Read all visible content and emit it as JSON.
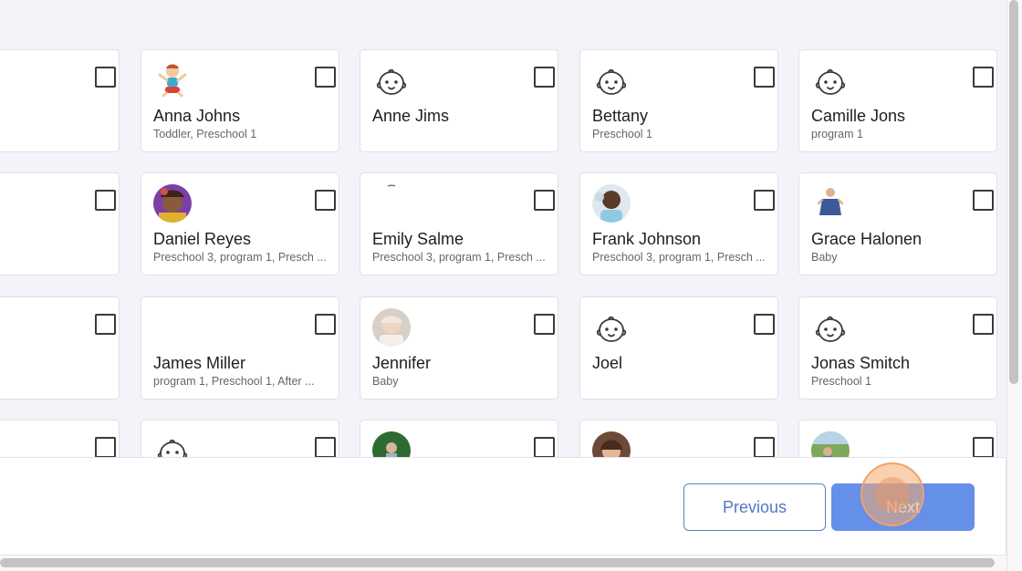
{
  "students": [
    [
      {
        "name": "",
        "sub": "",
        "avatar": "none"
      },
      {
        "name": "Anna Johns",
        "sub": "Toddler, Preschool 1",
        "avatar": "cartoon-child"
      },
      {
        "name": "Anne Jims",
        "sub": "",
        "avatar": "baby-icon"
      },
      {
        "name": "Bettany",
        "sub": "Preschool 1",
        "avatar": "baby-icon"
      },
      {
        "name": "Camille Jons",
        "sub": "program 1",
        "avatar": "baby-icon"
      }
    ],
    [
      {
        "name": "",
        "sub": "",
        "avatar": "none"
      },
      {
        "name": "Daniel Reyes",
        "sub": "Preschool 3, program 1, Presch ...",
        "avatar": "photo-daniel"
      },
      {
        "name": "Emily Salme",
        "sub": "Preschool 3, program 1, Presch ...",
        "avatar": "photo-emily"
      },
      {
        "name": "Frank Johnson",
        "sub": "Preschool 3, program 1, Presch ...",
        "avatar": "photo-frank"
      },
      {
        "name": "Grace Halonen",
        "sub": "Baby",
        "avatar": "photo-grace"
      }
    ],
    [
      {
        "name": "",
        "sub": "",
        "avatar": "none"
      },
      {
        "name": "James Miller",
        "sub": "program 1, Preschool 1, After ...",
        "avatar": "none"
      },
      {
        "name": "Jennifer",
        "sub": "Baby",
        "avatar": "photo-jennifer"
      },
      {
        "name": "Joel",
        "sub": "",
        "avatar": "baby-icon"
      },
      {
        "name": "Jonas Smitch",
        "sub": "Preschool 1",
        "avatar": "baby-icon"
      }
    ],
    [
      {
        "name": "",
        "sub": "",
        "avatar": "none"
      },
      {
        "name": "",
        "sub": "",
        "avatar": "baby-icon"
      },
      {
        "name": "",
        "sub": "",
        "avatar": "photo-outdoor"
      },
      {
        "name": "",
        "sub": "",
        "avatar": "photo-girl"
      },
      {
        "name": "",
        "sub": "",
        "avatar": "photo-park"
      }
    ]
  ],
  "footer": {
    "previous_label": "Previous",
    "next_label": "Next"
  },
  "colors": {
    "accent": "#6590ea",
    "accent_outline": "#5b7fcb",
    "click_indicator": "#f0a26a"
  }
}
